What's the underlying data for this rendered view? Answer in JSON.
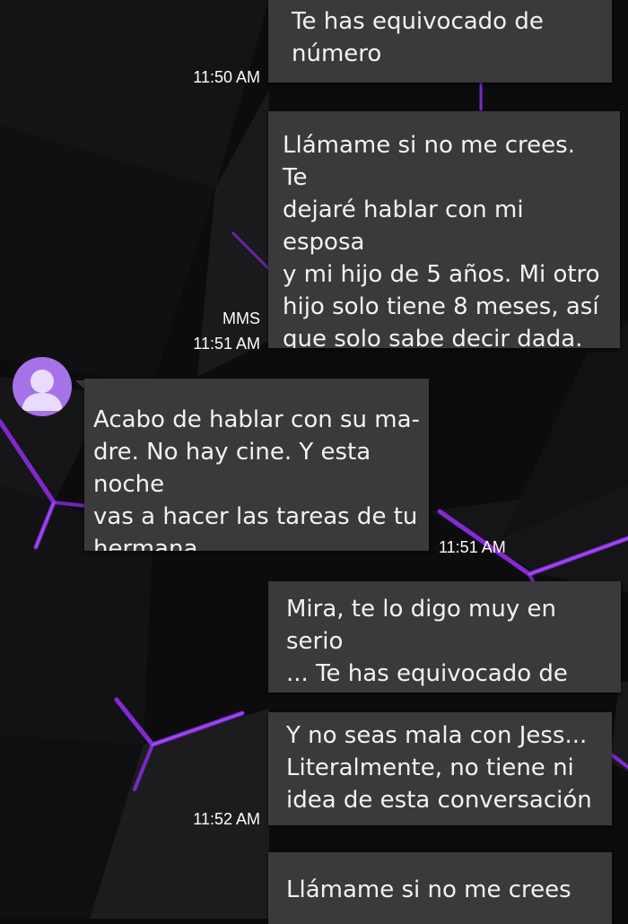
{
  "colors": {
    "background": "#0b0b0d",
    "bubble": "#3a3a3c",
    "bubble_text": "#f2f2f2",
    "accent_glow": "#8a2be2",
    "avatar": "#a672e8"
  },
  "messages": [
    {
      "direction": "outgoing",
      "text": "Te has equivocado de\nnúmero",
      "time": "11:50 AM"
    },
    {
      "direction": "outgoing",
      "text": "Llámame si no me crees. Te\ndejaré hablar con mi esposa\ny mi hijo de 5 años. Mi otro\nhijo solo tiene 8 meses, así\nque solo sabe decir dada. Y\ntú no eres su dada.",
      "type_label": "MMS",
      "time": "11:51 AM"
    },
    {
      "direction": "incoming",
      "text": "Acabo de hablar con su ma-\ndre. No hay cine. Y esta noche\nvas a hacer las tareas de tu\nhermana.",
      "time": "11:51 AM",
      "avatar_icon": "person-icon"
    },
    {
      "direction": "outgoing",
      "text": "Mira, te lo digo muy en serio\n... Te has equivocado de\nnúmero.",
      "time": ""
    },
    {
      "direction": "outgoing",
      "text": "Y no seas mala con Jess...\nLiteralmente, no tiene ni\nidea de esta conversación",
      "time": "11:52 AM"
    },
    {
      "direction": "outgoing",
      "text": "Llámame si no me crees",
      "time": ""
    }
  ]
}
